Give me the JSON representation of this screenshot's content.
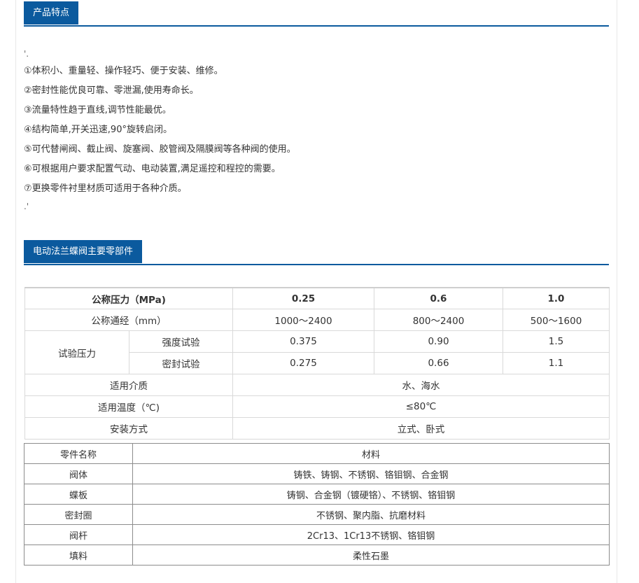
{
  "section1": {
    "title": "产品特点"
  },
  "features": {
    "lead_mark": "'.",
    "items": [
      "①体积小、重量轻、操作轻巧、便于安装、维修。",
      "②密封性能优良可靠、零泄漏,使用寿命长。",
      "③流量特性趋于直线,调节性能最优。",
      "④结构简单,开关迅速,90°旋转启闭。",
      "⑤可代替闸阀、截止阀、旋塞阀、胶管阀及隔膜阀等各种阀的使用。",
      "⑥可根据用户要求配置气动、电动装置,满足遥控和程控的需要。",
      "⑦更换零件衬里材质可适用于各种介质。"
    ],
    "tail_mark": ".'"
  },
  "section2": {
    "title": "电动法兰蝶阀主要零部件"
  },
  "spec_table": {
    "pressure_label": "公称压力（MPa)",
    "pressures": [
      "0.25",
      "0.6",
      "1.0"
    ],
    "diameter_label": "公称通经（mm）",
    "diameters": [
      "1000～2400",
      "800～2400",
      "500～1600"
    ],
    "test_label": "试验压力",
    "strength_label": "强度试验",
    "strength_values": [
      "0.375",
      "0.90",
      "1.5"
    ],
    "seal_label": "密封试验",
    "seal_values": [
      "0.275",
      "0.66",
      "1.1"
    ],
    "medium_label": "适用介质",
    "medium_value": "水、海水",
    "temp_label": "适用温度（℃)",
    "temp_value": "≤80℃",
    "install_label": "安装方式",
    "install_value": "立式、卧式"
  },
  "parts_table": {
    "header": {
      "name": "零件名称",
      "material": "材料"
    },
    "rows": [
      {
        "name": "阀体",
        "material": "铸铁、铸钢、不锈钢、铬钼钢、合金钢"
      },
      {
        "name": "蝶板",
        "material": "铸钢、合金钢（镀硬铬）、不锈钢、铬钼钢"
      },
      {
        "name": "密封圈",
        "material": "不锈钢、聚内脂、抗磨材料"
      },
      {
        "name": "阀杆",
        "material": "2Cr13、1Cr13不锈钢、铬钼钢"
      },
      {
        "name": "填料",
        "material": "柔性石墨"
      }
    ]
  }
}
